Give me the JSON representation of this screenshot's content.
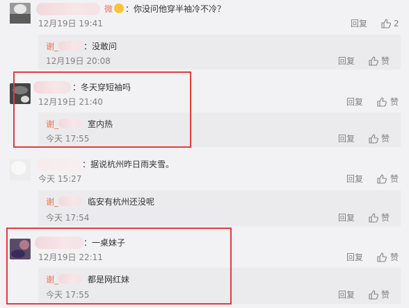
{
  "colors": {
    "frame": "#e53a35",
    "name": "#eb7350",
    "background": "#f2f2f5",
    "reply_bg": "#ebebee"
  },
  "comments": [
    {
      "name_suffix": "微",
      "text": "：你没问他穿半袖冷不冷？",
      "time": "12月19日 19:41",
      "reply_label": "回复",
      "like_count": "2",
      "replies": [
        {
          "name": "谢_",
          "text": "：没敢问",
          "time": "12月19日 20:08",
          "reply_label": "回复",
          "like_label": "赞"
        }
      ]
    },
    {
      "text": "：冬天穿短袖吗",
      "time": "12月19日 21:40",
      "reply_label": "回复",
      "like_label": "赞",
      "replies": [
        {
          "name": "谢_",
          "text": "室内热",
          "time": "今天 17:55",
          "reply_label": "回复",
          "like_label": "赞"
        }
      ]
    },
    {
      "text": "：据说杭州昨日雨夹雪。",
      "time": "今天 15:27",
      "reply_label": "回复",
      "like_label": "赞",
      "replies": [
        {
          "name": "谢_",
          "text": "临安有杭州还没呢",
          "time": "今天 17:54",
          "reply_label": "回复",
          "like_label": "赞"
        }
      ]
    },
    {
      "text": "：一桌妹子",
      "time": "12月19日 22:11",
      "reply_label": "回复",
      "like_label": "赞",
      "replies": [
        {
          "name": "谢_",
          "text": "都是网红妹",
          "time": "今天 17:55",
          "reply_label": "回复",
          "like_label": "赞"
        }
      ]
    }
  ]
}
